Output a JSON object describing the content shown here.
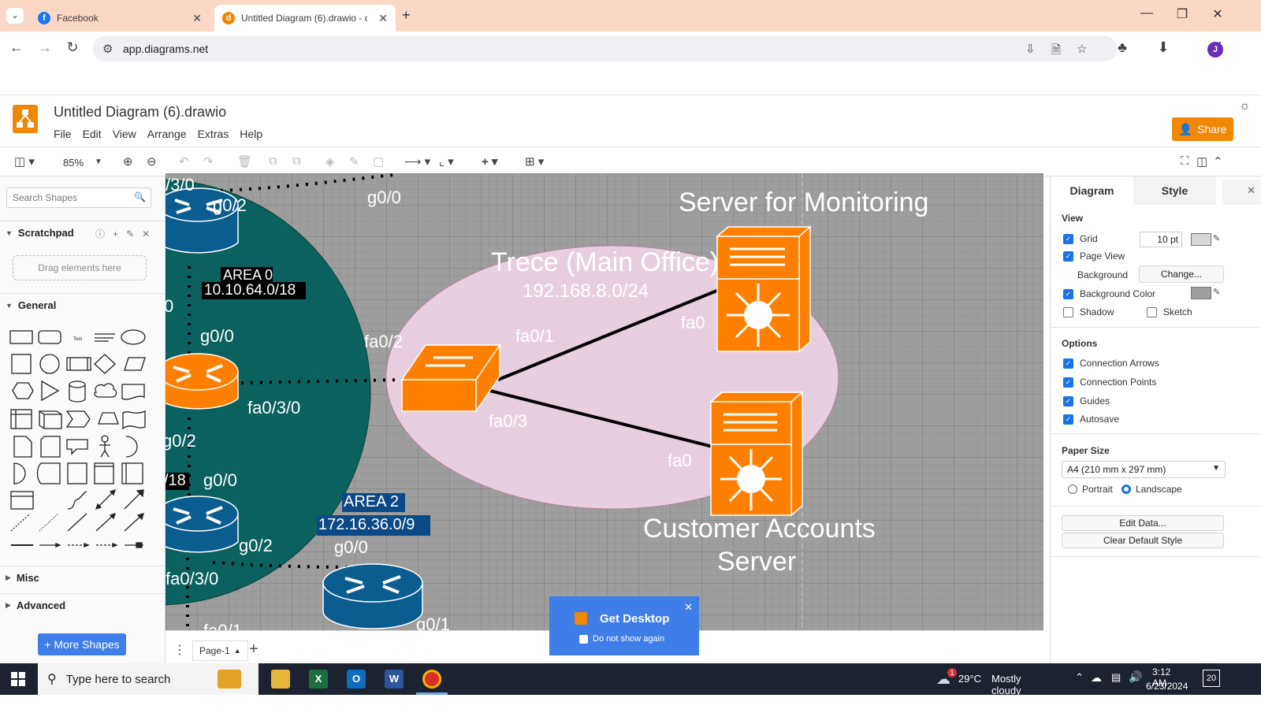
{
  "browser": {
    "tabs": [
      {
        "title": "Facebook",
        "active": false
      },
      {
        "title": "Untitled Diagram (6).drawio - d",
        "active": true
      }
    ],
    "url": "app.diagrams.net",
    "avatar_letter": "J"
  },
  "app": {
    "title": "Untitled Diagram (6).drawio",
    "menu": [
      "File",
      "Edit",
      "View",
      "Arrange",
      "Extras",
      "Help"
    ],
    "share_label": "Share",
    "zoom": "85%"
  },
  "sidebar": {
    "search_placeholder": "Search Shapes",
    "scratchpad_label": "Scratchpad",
    "drop_hint": "Drag elements here",
    "general_label": "General",
    "misc_label": "Misc",
    "advanced_label": "Advanced",
    "more_shapes_label": "+ More Shapes"
  },
  "diagram": {
    "labels": {
      "g03_0_top": "/3/0",
      "g02_top": "g0/2",
      "g00_topmid": "g0/0",
      "area0": "AREA 0",
      "area0_net": "10.10.64.0/18",
      "zero": "0",
      "g00_mid": "g0/0",
      "fa030_mid": "fa0/3/0",
      "g02_mid": "g0/2",
      "net18": "/18",
      "g00_low": "g0/0",
      "g02_low": "g0/2",
      "fa030_low": "fa0/3/0",
      "g00_bottom": "g0/0",
      "g01_bottom": "g0/1",
      "fa01_bottom": "fa0/1",
      "area2": "AREA 2",
      "area2_net": "172.16.36.0/9",
      "server_monitoring": "Server for Monitoring",
      "trece_title": "Trece (Main Office)",
      "trece_net": "192.168.8.0/24",
      "fa02": "fa0/2",
      "fa01": "fa0/1",
      "fa03": "fa0/3",
      "fa0_top": "fa0",
      "fa0_bottom": "fa0",
      "customer_server_1": "Customer Accounts",
      "customer_server_2": "Server"
    },
    "colors": {
      "canvas": "#9e9e9e",
      "ospf_area": "#0a615e",
      "office_ellipse": "#e8cfe0",
      "router_blue": "#0b5c8f",
      "device_orange": "#ff8000"
    }
  },
  "page": {
    "tab_label": "Page-1"
  },
  "format_panel": {
    "tabs": [
      "Diagram",
      "Style"
    ],
    "view_header": "View",
    "grid_label": "Grid",
    "grid_size": "10 pt",
    "page_view_label": "Page View",
    "background_label": "Background",
    "change_label": "Change...",
    "background_color_label": "Background Color",
    "shadow_label": "Shadow",
    "sketch_label": "Sketch",
    "options_header": "Options",
    "connection_arrows": "Connection Arrows",
    "connection_points": "Connection Points",
    "guides": "Guides",
    "autosave": "Autosave",
    "paper_size_header": "Paper Size",
    "paper_size_value": "A4 (210 mm x 297 mm)",
    "portrait": "Portrait",
    "landscape": "Landscape",
    "edit_data": "Edit Data...",
    "clear_default_style": "Clear Default Style"
  },
  "popup": {
    "title": "Get Desktop",
    "option": "Do not show again"
  },
  "taskbar": {
    "search_placeholder": "Type here to search",
    "weather_temp": "29°C",
    "weather_desc": "Mostly cloudy",
    "time": "3:12 AM",
    "date": "6/23/2024",
    "notifications": "20",
    "weather_badge": "1"
  }
}
